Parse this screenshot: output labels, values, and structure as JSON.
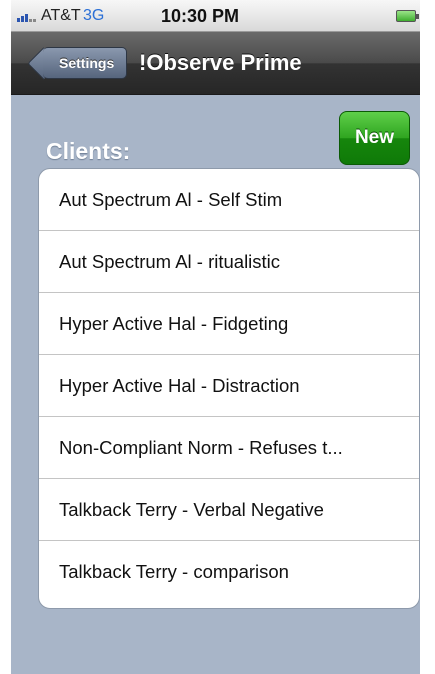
{
  "status_bar": {
    "carrier": "AT&T",
    "network": "3G",
    "time": "10:30 PM"
  },
  "nav_bar": {
    "back_label": "Settings",
    "title": "!Observe Prime"
  },
  "clients": {
    "header": "Clients:",
    "new_label": "New",
    "items": [
      "Aut Spectrum Al - Self Stim",
      "Aut Spectrum Al - ritualistic",
      "Hyper Active Hal - Fidgeting",
      "Hyper Active Hal - Distraction",
      "Non-Compliant Norm - Refuses t...",
      "Talkback Terry - Verbal Negative",
      "Talkback Terry - comparison"
    ]
  },
  "colors": {
    "background": "#a8b5c8",
    "nav_bar": "#333333",
    "new_button": "#2fa520",
    "network_text": "#2b6fd6"
  },
  "icons": {
    "signal": "signal-bars-icon",
    "battery": "battery-icon"
  }
}
